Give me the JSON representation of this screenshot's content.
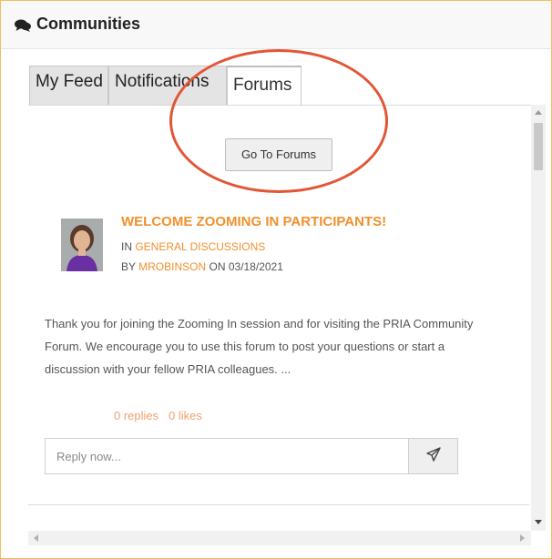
{
  "header": {
    "title": "Communities",
    "icon": "comments-icon"
  },
  "tabs": [
    {
      "label": "My Feed",
      "active": false
    },
    {
      "label": "Notifications",
      "active": false
    },
    {
      "label": "Forums",
      "active": true
    }
  ],
  "forums": {
    "go_button_label": "Go To Forums",
    "highlight_color": "#e25636"
  },
  "post": {
    "title": "WELCOME ZOOMING IN PARTICIPANTS!",
    "in_prefix": "IN",
    "category": "GENERAL DISCUSSIONS",
    "by_prefix": "BY",
    "author": "MROBINSON",
    "on_prefix": "ON",
    "date": "03/18/2021",
    "body_line1": "Thank you for joining the Zooming In session and for visiting the PRIA Community",
    "body_line2": "Forum.  We encourage you to use this forum to post your questions or start a",
    "body_line3": "discussion with your fellow PRIA colleagues.  ...",
    "replies": "0 replies",
    "likes": "0 likes"
  },
  "reply": {
    "placeholder": "Reply now...",
    "send_icon": "send-icon"
  },
  "colors": {
    "accent": "#f0902c",
    "panel_border": "#f0c060",
    "header_bg": "#f8f8f8"
  }
}
